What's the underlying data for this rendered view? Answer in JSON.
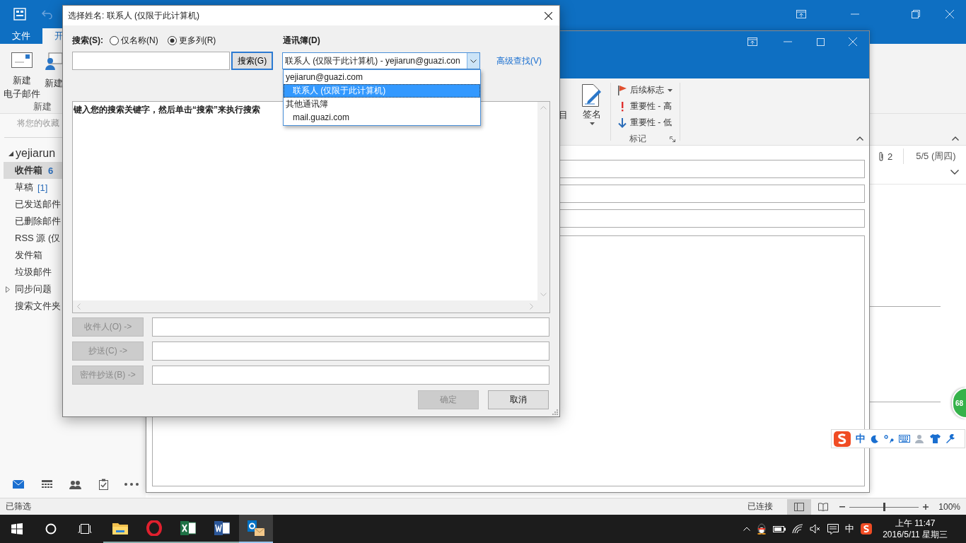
{
  "main_window": {
    "ribbon_tabs": [
      {
        "label": "文件",
        "selected": false
      },
      {
        "label": "开",
        "selected": true
      }
    ],
    "ribbon_buttons": [
      {
        "kind": "mail",
        "lines": [
          "新建",
          "电子邮件"
        ]
      },
      {
        "kind": "item",
        "lines": [
          "新建"
        ]
      }
    ],
    "ribbon_group": "新建",
    "favorites_hint": "将您的收藏",
    "account": {
      "name": "yejiarun",
      "expanded": true
    },
    "folders": [
      {
        "kind": "folder",
        "name": "收件箱",
        "count": "6",
        "selected": true
      },
      {
        "kind": "folder",
        "name": "草稿",
        "count": "[1]",
        "selected": false
      },
      {
        "kind": "folder",
        "name": "已发送邮件",
        "selected": false
      },
      {
        "kind": "folder",
        "name": "已删除邮件",
        "selected": false
      },
      {
        "kind": "folder",
        "name": "RSS 源 (仅",
        "selected": false
      },
      {
        "kind": "folder",
        "name": "发件箱",
        "selected": false
      },
      {
        "kind": "folder",
        "name": "垃圾邮件",
        "selected": false
      },
      {
        "kind": "expander",
        "name": "同步问题",
        "selected": false
      },
      {
        "kind": "folder",
        "name": "搜索文件夹",
        "selected": false
      }
    ],
    "nav": [
      {
        "kind": "mail",
        "selected": true
      },
      {
        "kind": "calendar",
        "selected": false
      },
      {
        "kind": "people",
        "selected": false
      },
      {
        "kind": "tasks",
        "selected": false
      },
      {
        "kind": "more",
        "selected": false
      }
    ],
    "reading_pane": {
      "attachments": "2",
      "date": "5/5 (周四)"
    },
    "status_bar": {
      "left": "已筛选",
      "connection": "已连接",
      "views": [
        {
          "kind": "normal",
          "selected": true
        },
        {
          "kind": "reading",
          "selected": false
        }
      ],
      "zoom": {
        "level": 0.5,
        "reading": "100%"
      }
    }
  },
  "compose_window": {
    "ribbon_items": [
      {
        "kind": "partial",
        "label": "目"
      },
      {
        "kind": "signature",
        "label": "签名"
      }
    ],
    "tag_items": [
      {
        "kind": "flag",
        "label": "后续标志"
      },
      {
        "kind": "high",
        "label": "重要性 - 高"
      },
      {
        "kind": "low",
        "label": "重要性 - 低"
      }
    ],
    "tag_group": "标记"
  },
  "dialog": {
    "title": "选择姓名: 联系人 (仅限于此计算机)",
    "search_label": "搜索(S):",
    "search_modes": [
      {
        "label": "仅名称(N)",
        "selected": false
      },
      {
        "label": "更多列(R)",
        "selected": true
      }
    ],
    "search_button": "搜索(G)",
    "address_book_label": "通讯簿(D)",
    "address_book": {
      "value": "联系人 (仅限于此计算机) - yejiarun@guazi.con",
      "expanded": true,
      "options": [
        {
          "label": "yejiarun@guazi.com",
          "selected": false,
          "children": [
            {
              "label": "联系人 (仅限于此计算机)",
              "selected": true
            }
          ]
        },
        {
          "label": "其他通讯簿",
          "selected": false,
          "children": [
            {
              "label": "mail.guazi.com",
              "selected": false
            }
          ]
        }
      ]
    },
    "advanced_link": "高级查找(V)",
    "results_hint": "键入您的搜索关键字，然后单击“搜索”来执行搜索",
    "recipients": [
      {
        "label": "收件人(O) ->",
        "disabled": true
      },
      {
        "label": "抄送(C) ->",
        "disabled": true
      },
      {
        "label": "密件抄送(B) ->",
        "disabled": true
      }
    ],
    "ok_button": {
      "label": "确定",
      "disabled": true
    },
    "cancel_button": {
      "label": "取消",
      "disabled": false
    }
  },
  "ime_toolbar": {
    "mode": "中"
  },
  "floating_badge": "68",
  "taskbar": {
    "apps": [
      {
        "kind": "explorer",
        "selected": false
      },
      {
        "kind": "opera",
        "selected": false
      },
      {
        "kind": "excel",
        "selected": false
      },
      {
        "kind": "word",
        "selected": false
      },
      {
        "kind": "outlook",
        "selected": true
      }
    ],
    "tray_ime": "中",
    "time": "上午 11:47",
    "date": "2016/5/11 星期三"
  }
}
